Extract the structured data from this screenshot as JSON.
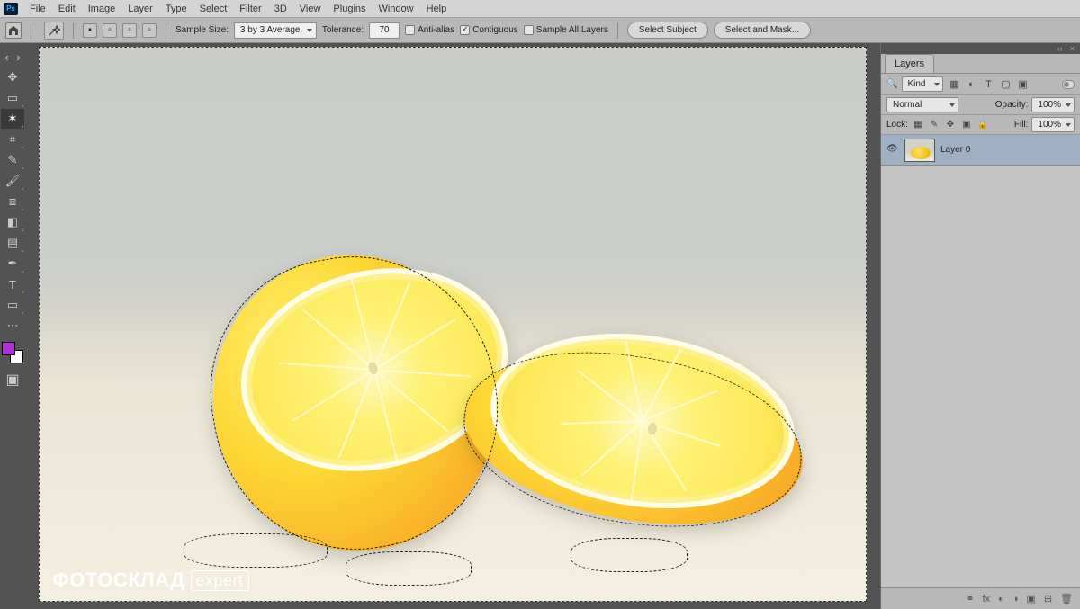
{
  "menu": {
    "items": [
      "File",
      "Edit",
      "Image",
      "Layer",
      "Type",
      "Select",
      "Filter",
      "3D",
      "View",
      "Plugins",
      "Window",
      "Help"
    ],
    "logo": "Ps"
  },
  "options": {
    "sample_size_label": "Sample Size:",
    "sample_size_value": "3 by 3 Average",
    "tolerance_label": "Tolerance:",
    "tolerance_value": "70",
    "anti_alias": "Anti-alias",
    "contiguous": "Contiguous",
    "sample_all": "Sample All Layers",
    "select_subject": "Select Subject",
    "select_and_mask": "Select and Mask..."
  },
  "tools": [
    {
      "name": "move-tool",
      "glyph": "✥"
    },
    {
      "name": "marquee-tool",
      "glyph": "▭"
    },
    {
      "name": "lasso-tool",
      "glyph": "⟆"
    },
    {
      "name": "magic-wand-tool",
      "glyph": "✶",
      "active": true
    },
    {
      "name": "crop-tool",
      "glyph": "⌗"
    },
    {
      "name": "frame-tool",
      "glyph": "▣"
    },
    {
      "name": "eyedropper-tool",
      "glyph": "✎"
    },
    {
      "name": "healing-brush-tool",
      "glyph": "✚"
    },
    {
      "name": "brush-tool",
      "glyph": "✏"
    },
    {
      "name": "clone-stamp-tool",
      "glyph": "⧈"
    },
    {
      "name": "history-brush-tool",
      "glyph": "↺"
    },
    {
      "name": "eraser-tool",
      "glyph": "◧"
    },
    {
      "name": "gradient-tool",
      "glyph": "▤"
    },
    {
      "name": "blur-tool",
      "glyph": "◉"
    },
    {
      "name": "dodge-tool",
      "glyph": "☀"
    },
    {
      "name": "more-tools",
      "glyph": "⋯"
    }
  ],
  "colors": {
    "foreground": "#b030d8",
    "background": "#ffffff"
  },
  "layers_panel": {
    "tab": "Layers",
    "filter_kind": "Kind",
    "blend_mode": "Normal",
    "opacity_label": "Opacity:",
    "opacity_value": "100%",
    "lock_label": "Lock:",
    "fill_label": "Fill:",
    "fill_value": "100%",
    "layers": [
      {
        "name": "Layer 0",
        "visible": true
      }
    ],
    "footer_icons": [
      "link",
      "fx",
      "mask",
      "adjust",
      "group",
      "new",
      "trash"
    ]
  },
  "watermark": {
    "main": "ФОТОСКЛАД",
    "sub": "expert"
  }
}
